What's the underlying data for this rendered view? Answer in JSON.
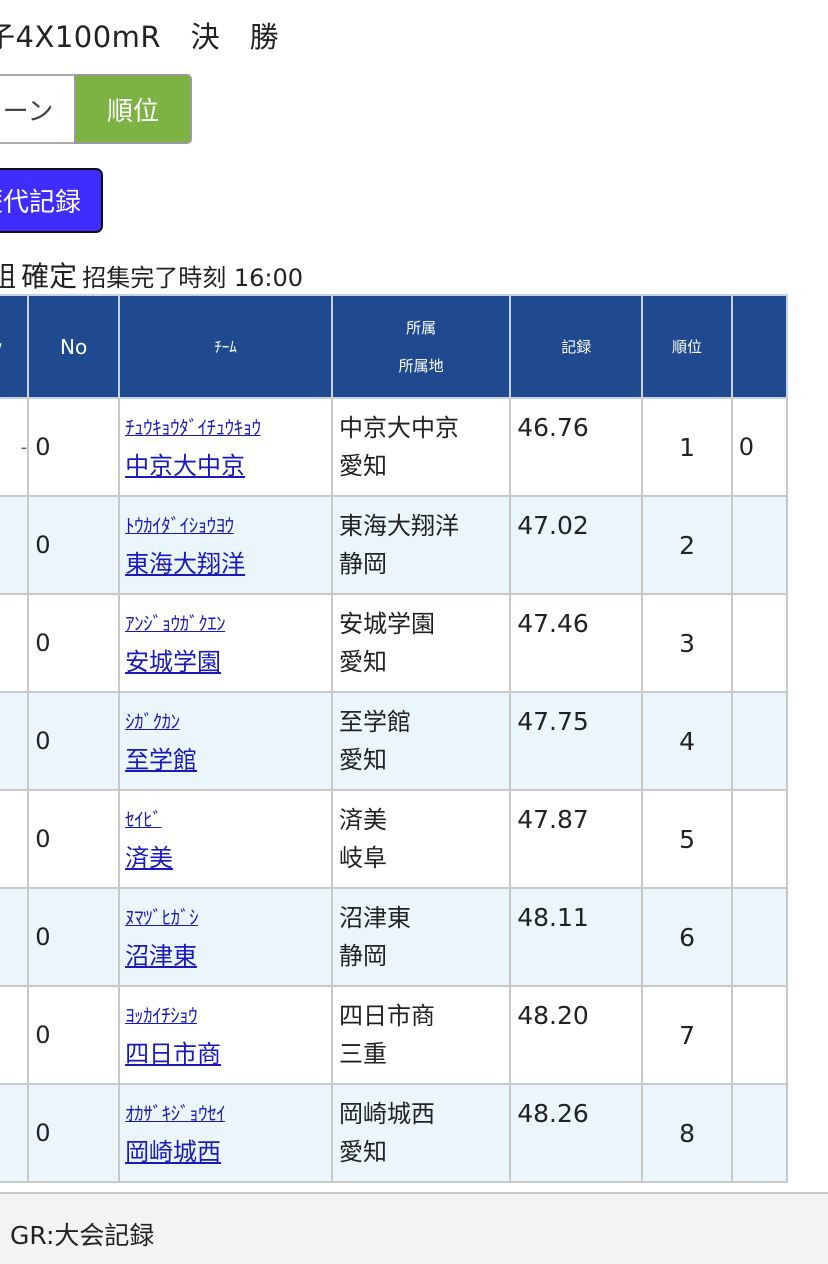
{
  "event": {
    "title": "子4X100mR　決　勝"
  },
  "toggle": {
    "lane_label": "ーン",
    "rank_label": "順位"
  },
  "history_button": {
    "label": "歴代記録"
  },
  "status": {
    "prefix": "組",
    "state": "確定",
    "call_time": "招集完了時刻 16:00"
  },
  "table": {
    "headers": {
      "lane": "ッ",
      "no": "No",
      "team": "ﾁｰﾑ",
      "affiliation_line1": "所属",
      "affiliation_line2": "所属地",
      "record": "記録",
      "rank": "順位"
    },
    "rows": [
      {
        "lane_fragment": "-",
        "no": "0",
        "team_kana": "ﾁｭｳｷｮｳﾀﾞｲﾁｭｳｷｮｳ",
        "team_name": "中京大中京",
        "affiliation": "中京大中京",
        "prefecture": "愛知",
        "record": "46.76",
        "rank": "1",
        "extra": "0"
      },
      {
        "lane_fragment": "",
        "no": "0",
        "team_kana": "ﾄｳｶｲﾀﾞｲｼｮｳﾖｳ",
        "team_name": "東海大翔洋",
        "affiliation": "東海大翔洋",
        "prefecture": "静岡",
        "record": "47.02",
        "rank": "2",
        "extra": ""
      },
      {
        "lane_fragment": "",
        "no": "0",
        "team_kana": "ｱﾝｼﾞｮｳｶﾞｸｴﾝ",
        "team_name": "安城学園",
        "affiliation": "安城学園",
        "prefecture": "愛知",
        "record": "47.46",
        "rank": "3",
        "extra": ""
      },
      {
        "lane_fragment": "",
        "no": "0",
        "team_kana": "ｼｶﾞｸｶﾝ",
        "team_name": "至学館",
        "affiliation": "至学館",
        "prefecture": "愛知",
        "record": "47.75",
        "rank": "4",
        "extra": ""
      },
      {
        "lane_fragment": "",
        "no": "0",
        "team_kana": "ｾｲﾋﾞ",
        "team_name": "済美",
        "affiliation": "済美",
        "prefecture": "岐阜",
        "record": "47.87",
        "rank": "5",
        "extra": ""
      },
      {
        "lane_fragment": "",
        "no": "0",
        "team_kana": "ﾇﾏﾂﾞﾋｶﾞｼ",
        "team_name": "沼津東",
        "affiliation": "沼津東",
        "prefecture": "静岡",
        "record": "48.11",
        "rank": "6",
        "extra": ""
      },
      {
        "lane_fragment": "",
        "no": "0",
        "team_kana": "ﾖｯｶｲﾁｼｮｳ",
        "team_name": "四日市商",
        "affiliation": "四日市商",
        "prefecture": "三重",
        "record": "48.20",
        "rank": "7",
        "extra": ""
      },
      {
        "lane_fragment": "",
        "no": "0",
        "team_kana": "ｵｶｻﾞｷｼﾞｮｳｾｲ",
        "team_name": "岡崎城西",
        "affiliation": "岡崎城西",
        "prefecture": "愛知",
        "record": "48.26",
        "rank": "8",
        "extra": ""
      }
    ]
  },
  "footer": {
    "note": "GR:大会記録"
  },
  "colors": {
    "header_bg": "#1f4a8f",
    "rank_toggle_bg": "#7cb342",
    "history_button_bg": "#3f2cff",
    "row_alt_bg": "#eaf6fb",
    "link_color": "#1a1ab8"
  }
}
